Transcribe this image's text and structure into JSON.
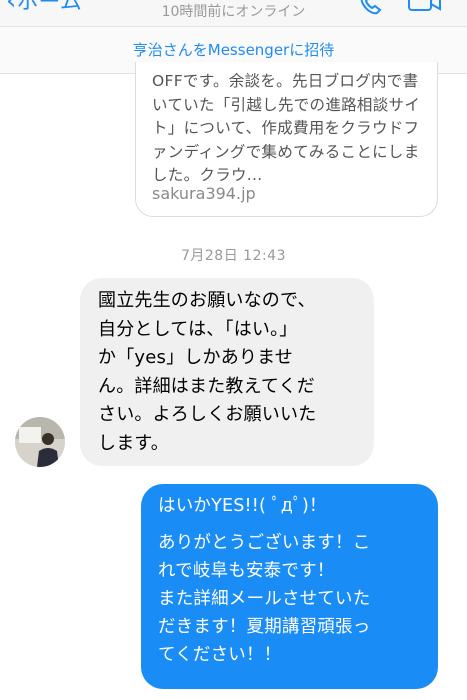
{
  "header": {
    "back_label": "ホーム",
    "status": "10時間前にオンライン",
    "icons": [
      "chevron-left-icon",
      "phone-icon",
      "video-camera-icon"
    ]
  },
  "invite": {
    "label": "亨治さんをMessengerに招待"
  },
  "link_preview": {
    "description": "OFFです。余談を。先日ブログ内で書いていた「引越し先での進路相談サイト」について、作成費用をクラウドファンディングで集めてみることにしました。クラウ...",
    "domain": "sakura394.jp"
  },
  "timestamp": "7月28日 12:43",
  "messages": {
    "incoming": {
      "lines": [
        "國立先生のお願いなので、",
        "自分としては、「はい。」",
        "か「yes」しかありませ",
        "ん。詳細はまた教えてくだ",
        "さい。よろしくお願いいた",
        "します。"
      ]
    },
    "outgoing": {
      "lines": [
        "はいかYES!!( ﾟдﾟ)！",
        "ありがとうございます！こ",
        "れで岐阜も安泰です！",
        "また詳細メールさせていた",
        "だきます！夏期講習頑張っ",
        "てください！！"
      ]
    }
  },
  "colors": {
    "accent": "#1f8cf5",
    "outgoing_bubble": "#1a8cf5",
    "incoming_bubble": "#f0f0f0"
  }
}
